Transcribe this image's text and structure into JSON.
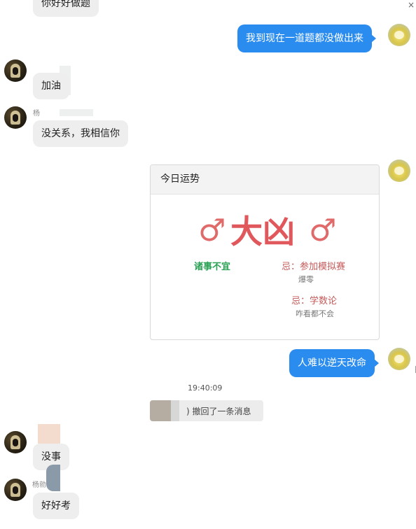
{
  "window": {
    "close_glyph": "×"
  },
  "messages": {
    "m0": "你好好做题",
    "m1": "我到现在一道题都没做出来",
    "m2": "加油",
    "m3_name": "杨",
    "m3": "没关系，我相信你",
    "m5": "人难以逆天改命",
    "m6": "没事",
    "m7_name": "杨勍",
    "m7": "好好考"
  },
  "fortune_card": {
    "title": "今日运势",
    "verdict": "大凶",
    "symbol": "♂",
    "good": "诸事不宜",
    "bad1": "忌：参加模拟赛",
    "bad1_sub": "爆零",
    "bad2": "忌：学数论",
    "bad2_sub": "咋看都不会"
  },
  "timestamp": "19:40:09",
  "recall_notice": ") 撤回了一条消息",
  "colors": {
    "outgoing_bubble": "#2b8cf0",
    "incoming_bubble": "#eeeeee",
    "verdict": "#e0575c",
    "good": "#2aa155",
    "bad": "#c45a5a"
  }
}
